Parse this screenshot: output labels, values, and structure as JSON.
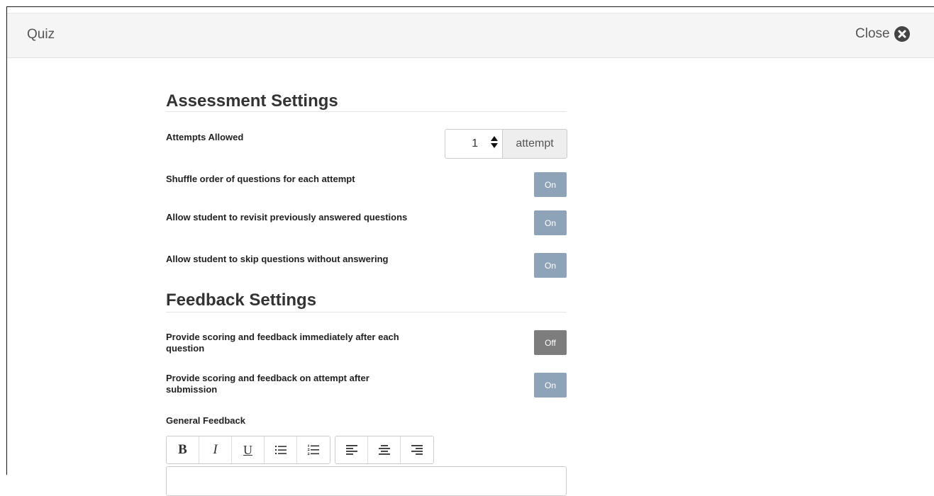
{
  "header": {
    "title": "Quiz",
    "close_label": "Close"
  },
  "assessment": {
    "title": "Assessment Settings",
    "attempts": {
      "label": "Attempts Allowed",
      "value": "1",
      "unit": "attempt"
    },
    "shuffle": {
      "label": "Shuffle order of questions for each attempt",
      "state": "On"
    },
    "revisit": {
      "label": "Allow student to revisit previously answered questions",
      "state": "On"
    },
    "skip": {
      "label": "Allow student to skip questions without answering",
      "state": "On"
    }
  },
  "feedback": {
    "title": "Feedback Settings",
    "immediate": {
      "label": "Provide scoring and feedback immediately after each question",
      "state": "Off"
    },
    "after_submission": {
      "label": "Provide scoring and feedback on attempt after submission",
      "state": "On"
    },
    "general_label": "General Feedback",
    "toolbar": {
      "bold": "B",
      "italic": "I",
      "underline": "U",
      "icons": [
        "unordered-list-icon",
        "ordered-list-icon",
        "align-left-icon",
        "align-center-icon",
        "align-right-icon"
      ]
    }
  },
  "colors": {
    "toggle_on": "#8fa3b8",
    "toggle_off": "#7d7d7d",
    "header_bg": "#f5f5f5"
  }
}
